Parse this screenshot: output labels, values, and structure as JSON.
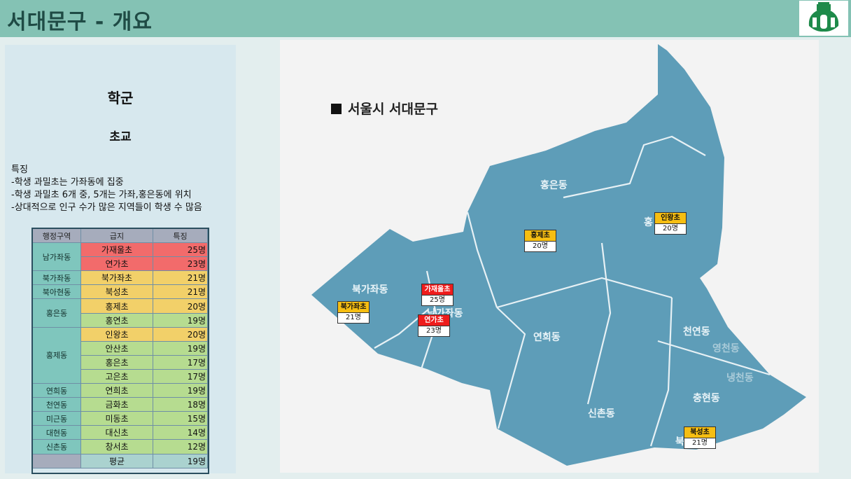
{
  "header": {
    "title": "서대문구 - 개요"
  },
  "left": {
    "heading1": "학군",
    "heading2": "초교",
    "features": [
      "특징",
      "-학생 과밀초는 가좌동에 집중",
      "-학생 과밀초 6개 중, 5개는 가좌,홍은동에 위치",
      "-상대적으로 인구 수가 많은 지역들이 학생 수 많음"
    ],
    "table": {
      "headers": [
        "행정구역",
        "급지",
        "특징"
      ],
      "groups": [
        {
          "district": "남가좌동",
          "rows": [
            {
              "school": "가재울초",
              "count": "25명",
              "level": "red"
            },
            {
              "school": "연가초",
              "count": "23명",
              "level": "red"
            }
          ]
        },
        {
          "district": "북가좌동",
          "rows": [
            {
              "school": "북가좌초",
              "count": "21명",
              "level": "yellow"
            }
          ]
        },
        {
          "district": "북아현동",
          "rows": [
            {
              "school": "북성초",
              "count": "21명",
              "level": "yellow"
            }
          ]
        },
        {
          "district": "홍은동",
          "rows": [
            {
              "school": "홍제초",
              "count": "20명",
              "level": "yellow"
            },
            {
              "school": "홍연초",
              "count": "19명",
              "level": "green"
            }
          ]
        },
        {
          "district": "홍제동",
          "rows": [
            {
              "school": "인왕초",
              "count": "20명",
              "level": "yellow"
            },
            {
              "school": "안산초",
              "count": "19명",
              "level": "green"
            },
            {
              "school": "홍은초",
              "count": "17명",
              "level": "green"
            },
            {
              "school": "고은초",
              "count": "17명",
              "level": "green"
            }
          ]
        },
        {
          "district": "연희동",
          "rows": [
            {
              "school": "연희초",
              "count": "19명",
              "level": "green"
            }
          ]
        },
        {
          "district": "천연동",
          "rows": [
            {
              "school": "금화초",
              "count": "18명",
              "level": "green"
            }
          ]
        },
        {
          "district": "미근동",
          "rows": [
            {
              "school": "미동초",
              "count": "15명",
              "level": "green"
            }
          ]
        },
        {
          "district": "대현동",
          "rows": [
            {
              "school": "대신초",
              "count": "14명",
              "level": "green"
            }
          ]
        },
        {
          "district": "신촌동",
          "rows": [
            {
              "school": "창서초",
              "count": "12명",
              "level": "green"
            }
          ]
        },
        {
          "district": "",
          "rows": [
            {
              "school": "평균",
              "count": "19명",
              "level": "avg"
            }
          ]
        }
      ]
    }
  },
  "map": {
    "legend": "서울시 서대문구",
    "dongs": [
      {
        "name": "홍은동"
      },
      {
        "name": "북가좌동"
      },
      {
        "name": "남가좌동"
      },
      {
        "name": "연희동"
      },
      {
        "name": "천연동"
      },
      {
        "name": "영천동"
      },
      {
        "name": "냉천동"
      },
      {
        "name": "충현동"
      },
      {
        "name": "신촌동"
      },
      {
        "name": "홍"
      },
      {
        "name": "북"
      }
    ],
    "badges": [
      {
        "name": "인왕초",
        "count": "20명",
        "color": "yellow"
      },
      {
        "name": "홍제초",
        "count": "20명",
        "color": "yellow"
      },
      {
        "name": "가재울초",
        "count": "25명",
        "color": "red"
      },
      {
        "name": "연가초",
        "count": "23명",
        "color": "red"
      },
      {
        "name": "북가좌초",
        "count": "21명",
        "color": "yellow"
      },
      {
        "name": "북성초",
        "count": "21명",
        "color": "yellow"
      }
    ]
  },
  "colors": {
    "header": "#84c2b4",
    "map_fill": "#5e9db8",
    "overcrowded": "#ee1c1c",
    "high": "#f6be12",
    "normal": "#b6dc90"
  }
}
